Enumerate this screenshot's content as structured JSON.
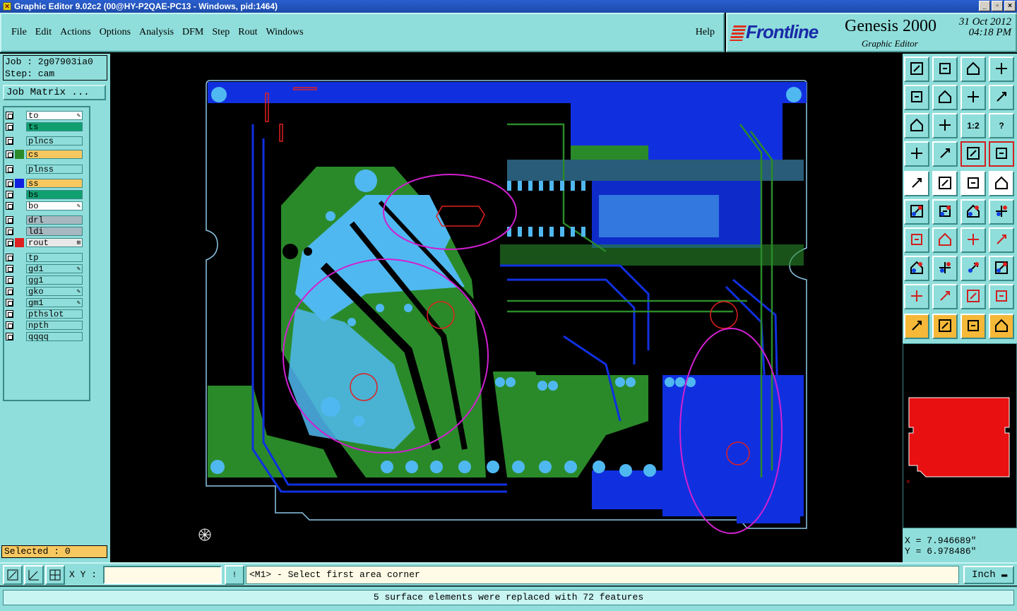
{
  "window": {
    "title": "Graphic Editor 9.02c2 (00@HY-P2QAE-PC13 - Windows, pid:1464)",
    "min": "_",
    "max": "▫",
    "close": "×"
  },
  "menu": {
    "items": [
      "File",
      "Edit",
      "Actions",
      "Options",
      "Analysis",
      "DFM",
      "Step",
      "Rout",
      "Windows"
    ],
    "help": "Help"
  },
  "brand": {
    "logo": "Frontline",
    "product": "Genesis 2000",
    "subtitle": "Graphic Editor",
    "date": "31 Oct 2012",
    "time": "04:18 PM"
  },
  "job": {
    "job_label": "Job : 2g07903ia0",
    "step_label": "Step: cam",
    "matrix_button": "Job Matrix ..."
  },
  "layers": [
    {
      "name": "to",
      "color": "#ffffff",
      "swatch": "",
      "mark": "✎"
    },
    {
      "name": "ts",
      "color": "#10a070",
      "swatch": "",
      "mark": ""
    },
    {
      "name": "plncs",
      "color": "#8fdedb",
      "swatch": "",
      "mark": ""
    },
    {
      "name": "cs",
      "color": "#f8c860",
      "swatch": "#2a8a2a",
      "mark": ""
    },
    {
      "name": "plnss",
      "color": "#8fdedb",
      "swatch": "",
      "mark": ""
    },
    {
      "name": "ss",
      "color": "#f8c860",
      "swatch": "#1020e0",
      "mark": ""
    },
    {
      "name": "bs",
      "color": "#10a070",
      "swatch": "",
      "mark": ""
    },
    {
      "name": "bo",
      "color": "#ffffff",
      "swatch": "",
      "mark": "✎"
    },
    {
      "name": "drl",
      "color": "#a8b8c0",
      "swatch": "",
      "mark": ""
    },
    {
      "name": "ldi",
      "color": "#a8b8c0",
      "swatch": "",
      "mark": ""
    },
    {
      "name": "rout",
      "color": "#e8e8e8",
      "swatch": "#e02020",
      "mark": "⊞"
    },
    {
      "name": "tp",
      "color": "#8fdedb",
      "swatch": "",
      "mark": ""
    },
    {
      "name": "gd1",
      "color": "#8fdedb",
      "swatch": "",
      "mark": "✎"
    },
    {
      "name": "gg1",
      "color": "#8fdedb",
      "swatch": "",
      "mark": ""
    },
    {
      "name": "gko",
      "color": "#8fdedb",
      "swatch": "",
      "mark": "✎"
    },
    {
      "name": "gm1",
      "color": "#8fdedb",
      "swatch": "",
      "mark": "✎"
    },
    {
      "name": "pthslot",
      "color": "#8fdedb",
      "swatch": "",
      "mark": ""
    },
    {
      "name": "npth",
      "color": "#8fdedb",
      "swatch": "",
      "mark": ""
    },
    {
      "name": "qqqq",
      "color": "#8fdedb",
      "swatch": "",
      "mark": ""
    }
  ],
  "selected_label": "Selected : 0",
  "toolbox": {
    "rows": [
      [
        "home-top-icon",
        "save-icon",
        "house-icon",
        "split-view-icon"
      ],
      [
        "move-left-icon",
        "move-right-icon",
        "undo-icon",
        "redo-icon"
      ],
      [
        "fit-icon",
        "zoom-center-icon",
        "1:2",
        "?"
      ],
      [
        "tools-icon",
        "probe-icon",
        "measure-icon",
        "snap-icon"
      ],
      [
        "arrow-out-icon",
        "triangle-icon",
        "ruler-icon",
        "dot-icon"
      ],
      [
        "connect-icon",
        "cross-icon",
        "line-icon",
        "line2-icon"
      ],
      [
        "angle-icon",
        "diagonal-icon",
        "arc-icon",
        "split-icon"
      ],
      [
        "vertex-icon",
        "merge-icon",
        "offset-icon",
        "circles-icon"
      ],
      [
        "tri1-icon",
        "tri2-icon",
        "tri3-icon",
        "tri4-icon"
      ],
      [
        "pointer-icon",
        "pointer-box-icon",
        "pointer-select-icon",
        "route-icon"
      ]
    ],
    "label_12": "1:2",
    "label_help": "?"
  },
  "coords": {
    "x": "X = 7.946689\"",
    "y": "Y = 6.978486\""
  },
  "bottom": {
    "xy_label": "X Y :",
    "xy_value": "",
    "bang": "!",
    "prompt": "<M1> - Select first area corner",
    "units": "Inch"
  },
  "status_message": "5 surface elements were replaced with 72 features",
  "colors": {
    "panel": "#8fdedb",
    "board_blue": "#1030e0",
    "board_green": "#2a8a2a",
    "board_light": "#50b8f0",
    "highlight_orange": "#f8c860"
  }
}
